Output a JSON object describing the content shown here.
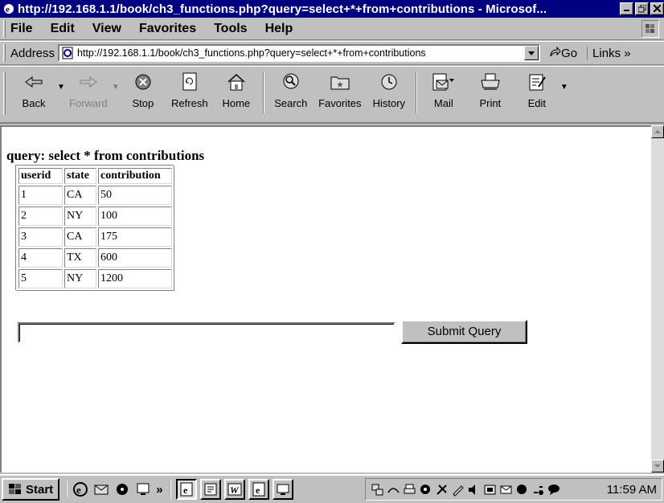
{
  "window": {
    "title": "http://192.168.1.1/book/ch3_functions.php?query=select+*+from+contributions - Microsof..."
  },
  "menu": {
    "items": [
      {
        "label": "File"
      },
      {
        "label": "Edit"
      },
      {
        "label": "View"
      },
      {
        "label": "Favorites"
      },
      {
        "label": "Tools"
      },
      {
        "label": "Help"
      }
    ]
  },
  "address": {
    "label": "Address",
    "url": "http://192.168.1.1/book/ch3_functions.php?query=select+*+from+contributions",
    "go_label": "Go",
    "links_label": "Links"
  },
  "toolbar": {
    "back": "Back",
    "forward": "Forward",
    "stop": "Stop",
    "refresh": "Refresh",
    "home": "Home",
    "search": "Search",
    "favorites": "Favorites",
    "history": "History",
    "mail": "Mail",
    "print": "Print",
    "edit": "Edit"
  },
  "page": {
    "query_text": "query: select * from contributions",
    "table": {
      "headers": [
        "userid",
        "state",
        "contribution"
      ],
      "rows": [
        [
          "1",
          "CA",
          "50"
        ],
        [
          "2",
          "NY",
          "100"
        ],
        [
          "3",
          "CA",
          "175"
        ],
        [
          "4",
          "TX",
          "600"
        ],
        [
          "5",
          "NY",
          "1200"
        ]
      ]
    },
    "input_value": "",
    "submit_label": "Submit Query"
  },
  "taskbar": {
    "start_label": "Start",
    "clock": "11:59 AM"
  },
  "colors": {
    "titlebar": "#000080",
    "chrome": "#c0c0c0",
    "content": "#ffffff"
  }
}
